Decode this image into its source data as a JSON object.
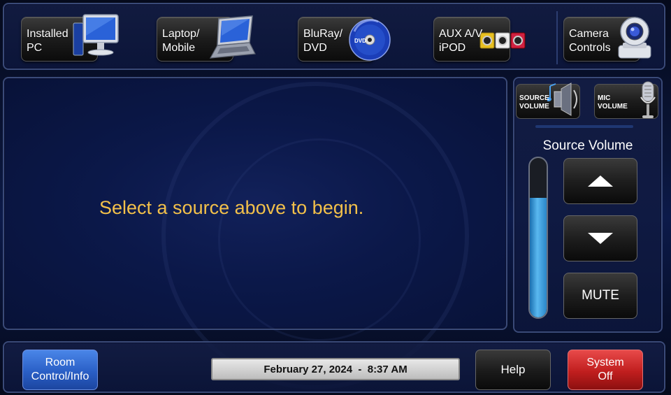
{
  "sources": [
    {
      "label": "Installed\nPC",
      "icon": "desktop-pc-icon"
    },
    {
      "label": "Laptop/\nMobile",
      "icon": "laptop-icon"
    },
    {
      "label": "BluRay/\nDVD",
      "icon": "disc-icon"
    },
    {
      "label": "AUX A/V\niPOD",
      "icon": "av-connectors-icon"
    },
    {
      "label": "Camera\nControls",
      "icon": "ptz-camera-icon"
    }
  ],
  "main": {
    "prompt": "Select a source above to begin.",
    "prompt_color": "#f2c04a"
  },
  "volume": {
    "source_volume_button": "SOURCE\nVOLUME",
    "mic_volume_button": "MIC\nVOLUME",
    "title": "Source Volume",
    "level_fraction": 0.75,
    "mute_label": "MUTE"
  },
  "footer": {
    "room_control_label": "Room\nControl/Info",
    "datetime": "February 27, 2024  -  8:37 AM",
    "help_label": "Help",
    "system_off_label": "System\nOff"
  },
  "colors": {
    "accent_blue": "#2a5fc6",
    "danger_red": "#c01e1e",
    "meter_blue": "#4aa8e8"
  }
}
